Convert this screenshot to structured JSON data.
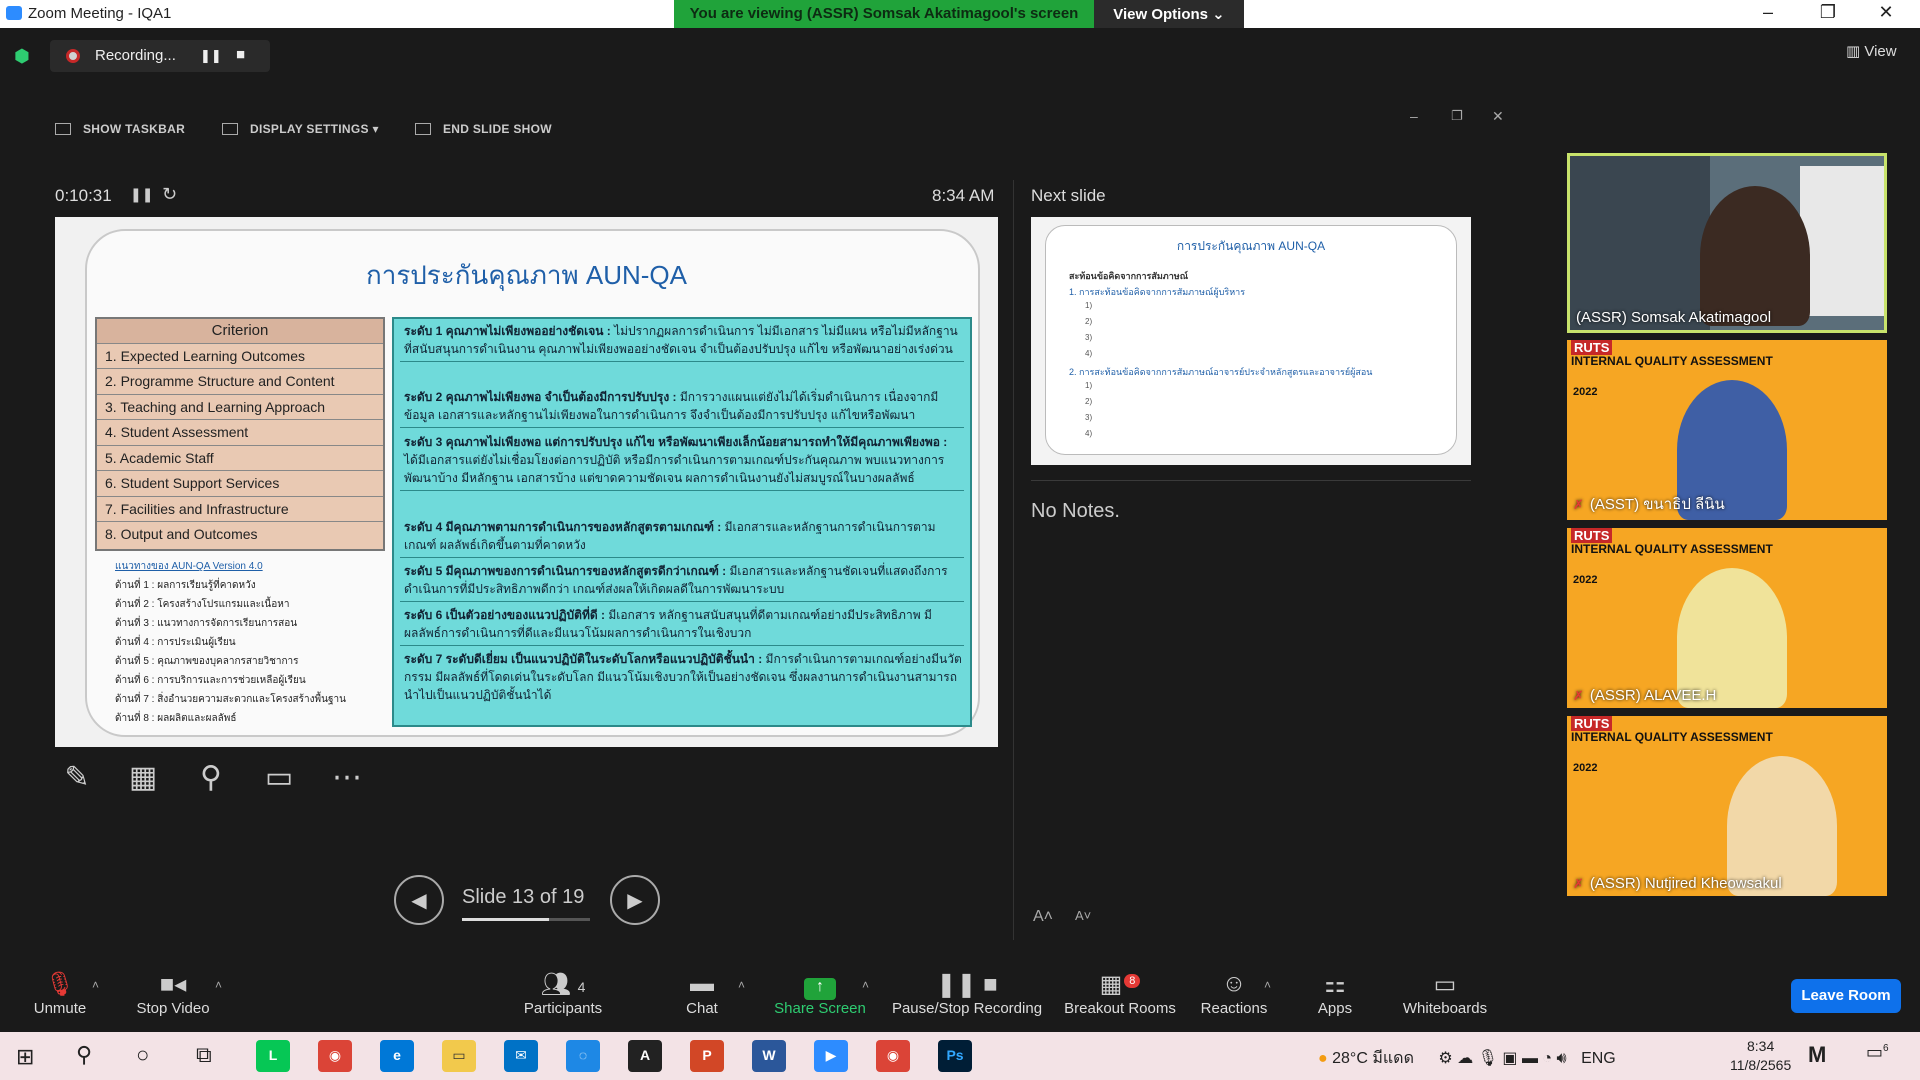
{
  "window": {
    "title": "Zoom Meeting - IQA1",
    "minimize": "–",
    "restore": "❐",
    "close": "✕"
  },
  "banner": {
    "viewing": "You are viewing (ASSR) Somsak Akatimagool's screen",
    "view_options": "View Options ⌄"
  },
  "recording": {
    "label": "Recording...",
    "pause": "❚❚",
    "stop": "■"
  },
  "view_label": "View",
  "presenter": {
    "tools": {
      "show_taskbar": "SHOW TASKBAR",
      "display_settings": "DISPLAY SETTINGS ▾",
      "end_show": "END SLIDE SHOW"
    },
    "timer": "0:10:31",
    "clock": "8:34 AM",
    "next_label": "Next slide",
    "no_notes": "No Notes.",
    "slide_counter": "Slide 13 of 19",
    "slide_progress": 0.68,
    "prev": "◀",
    "next": "▶",
    "font_up": "A˄",
    "font_down": "A˅",
    "win_min": "–",
    "win_restore": "❐",
    "win_close": "✕"
  },
  "slide": {
    "title": "การประกันคุณภาพ AUN-QA",
    "criterion_header": "Criterion",
    "criteria": [
      "1.   Expected Learning Outcomes",
      "2.   Programme Structure and Content",
      "3.   Teaching and Learning Approach",
      "4.   Student Assessment",
      "5.   Academic Staff",
      "6.   Student Support Services",
      "7.   Facilities and Infrastructure",
      "8.   Output and Outcomes"
    ],
    "legend_head": "แนวทางของ AUN-QA Version 4.0",
    "legend": [
      "ด้านที่ 1 : ผลการเรียนรู้ที่คาดหวัง",
      "ด้านที่ 2 : โครงสร้างโปรแกรมและเนื้อหา",
      "ด้านที่ 3 : แนวทางการจัดการเรียนการสอน",
      "ด้านที่ 4 : การประเมินผู้เรียน",
      "ด้านที่ 5 : คุณภาพของบุคลากรสายวิชาการ",
      "ด้านที่ 6 : การบริการและการช่วยเหลือผู้เรียน",
      "ด้านที่ 7 : สิ่งอำนวยความสะดวกและโครงสร้างพื้นฐาน",
      "ด้านที่ 8 : ผลผลิตและผลลัพธ์"
    ],
    "levels": [
      {
        "head": "ระดับ 1 คุณภาพไม่เพียงพออย่างชัดเจน :",
        "text": " ไม่ปรากฏผลการดำเนินการ ไม่มีเอกสาร ไม่มีแผน หรือไม่มีหลักฐานที่สนับสนุนการดำเนินงาน คุณภาพไม่เพียงพออย่างชัดเจน จำเป็นต้องปรับปรุง แก้ไข หรือพัฒนาอย่างเร่งด่วน"
      },
      {
        "head": "ระดับ 2 คุณภาพไม่เพียงพอ จำเป็นต้องมีการปรับปรุง :",
        "text": " มีการวางแผนแต่ยังไม่ได้เริ่มดำเนินการ เนื่องจากมีข้อมูล เอกสารและหลักฐานไม่เพียงพอในการดำเนินการ จึงจำเป็นต้องมีการปรับปรุง แก้ไขหรือพัฒนา"
      },
      {
        "head": "ระดับ 3 คุณภาพไม่เพียงพอ แต่การปรับปรุง แก้ไข หรือพัฒนาเพียงเล็กน้อยสามารถทำให้มีคุณภาพเพียงพอ :",
        "text": " ได้มีเอกสารแต่ยังไม่เชื่อมโยงต่อการปฏิบัติ หรือมีการดำเนินการตามเกณฑ์ประกันคุณภาพ พบแนวทางการพัฒนาบ้าง มีหลักฐาน เอกสารบ้าง แต่ขาดความชัดเจน ผลการดำเนินงานยังไม่สมบูรณ์ในบางผลลัพธ์"
      },
      {
        "head": "ระดับ 4 มีคุณภาพตามการดำเนินการของหลักสูตรตามเกณฑ์ :",
        "text": " มีเอกสารและหลักฐานการดำเนินการตามเกณฑ์ ผลลัพธ์เกิดขึ้นตามที่คาดหวัง"
      },
      {
        "head": "ระดับ 5 มีคุณภาพของการดำเนินการของหลักสูตรดีกว่าเกณฑ์ :",
        "text": " มีเอกสารและหลักฐานชัดเจนที่แสดงถึงการดำเนินการที่มีประสิทธิภาพดีกว่า เกณฑ์ส่งผลให้เกิดผลดีในการพัฒนาระบบ"
      },
      {
        "head": "ระดับ 6 เป็นตัวอย่างของแนวปฏิบัติที่ดี :",
        "text": " มีเอกสาร หลักฐานสนับสนุนที่ดีตามเกณฑ์อย่างมีประสิทธิภาพ มีผลลัพธ์การดำเนินการที่ดีและมีแนวโน้มผลการดำเนินการในเชิงบวก"
      },
      {
        "head": "ระดับ 7 ระดับดีเยี่ยม เป็นแนวปฏิบัติในระดับโลกหรือแนวปฏิบัติชั้นนำ :",
        "text": " มีการดำเนินการตามเกณฑ์อย่างมีนวัตกรรม มีผลลัพธ์ที่โดดเด่นในระดับโลก มีแนวโน้มเชิงบวกให้เป็นอย่างชัดเจน ซึ่งผลงานการดำเนินงานสามารถนำไปเป็นแนวปฏิบัติชั้นนำได้"
      }
    ]
  },
  "next_slide": {
    "title": "การประกันคุณภาพ AUN-QA",
    "heading": "สะท้อนข้อคิดจากการสัมภาษณ์",
    "item1": "1. การสะท้อนข้อคิดจากการสัมภาษณ์ผู้บริหาร",
    "item2": "2. การสะท้อนข้อคิดจากการสัมภาษณ์อาจารย์ประจำหลักสูตรและอาจารย์ผู้สอน",
    "nums": [
      "1)",
      "2)",
      "3)",
      "4)"
    ]
  },
  "gallery": [
    {
      "name": "(ASSR) Somsak Akatimagool"
    },
    {
      "name": "(ASST) ขนาธิป ลีนิน"
    },
    {
      "name": "(ASSR) ALAVEE.H"
    },
    {
      "name": "(ASSR) Nutjired Kheowsakul"
    }
  ],
  "iqa": {
    "logo": "RUTS",
    "title": "INTERNAL QUALITY ASSESSMENT",
    "year": "2022"
  },
  "toolbar": {
    "unmute": "Unmute",
    "stop_video": "Stop Video",
    "participants": "Participants",
    "participants_count": "4",
    "chat": "Chat",
    "share": "Share Screen",
    "pause_rec": "Pause/Stop Recording",
    "breakout": "Breakout Rooms",
    "breakout_badge": "8",
    "reactions": "Reactions",
    "apps": "Apps",
    "whiteboards": "Whiteboards",
    "leave": "Leave Room"
  },
  "taskbar": {
    "weather": "28°C มีแดด",
    "lang": "ENG",
    "time": "8:34",
    "date": "11/8/2565",
    "notif": "6"
  },
  "colors": {
    "accent": "#0e71eb",
    "share_green": "#20a33a",
    "badge_red": "#e53935"
  }
}
